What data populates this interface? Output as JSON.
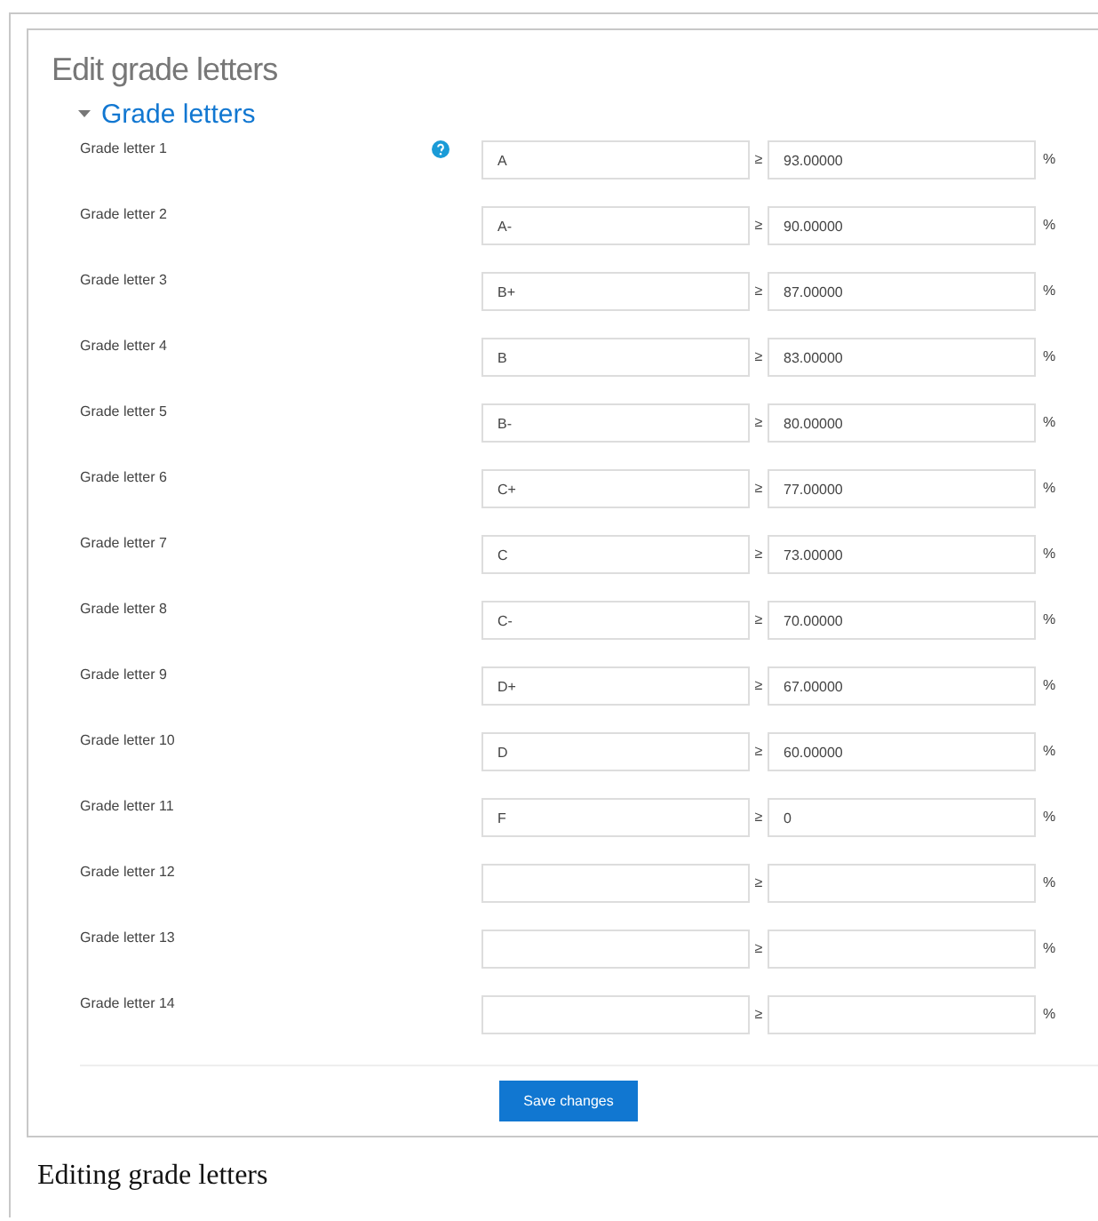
{
  "page_title": "Edit grade letters",
  "section": {
    "title": "Grade letters",
    "expanded": true
  },
  "rows": [
    {
      "label": "Grade letter 1",
      "help": true,
      "letter": "A",
      "sign": "≥",
      "boundary": "93.00000",
      "unit": "%"
    },
    {
      "label": "Grade letter 2",
      "help": false,
      "letter": "A-",
      "sign": "≥",
      "boundary": "90.00000",
      "unit": "%"
    },
    {
      "label": "Grade letter 3",
      "help": false,
      "letter": "B+",
      "sign": "≥",
      "boundary": "87.00000",
      "unit": "%"
    },
    {
      "label": "Grade letter 4",
      "help": false,
      "letter": "B",
      "sign": "≥",
      "boundary": "83.00000",
      "unit": "%"
    },
    {
      "label": "Grade letter 5",
      "help": false,
      "letter": "B-",
      "sign": "≥",
      "boundary": "80.00000",
      "unit": "%"
    },
    {
      "label": "Grade letter 6",
      "help": false,
      "letter": "C+",
      "sign": "≥",
      "boundary": "77.00000",
      "unit": "%"
    },
    {
      "label": "Grade letter 7",
      "help": false,
      "letter": "C",
      "sign": "≥",
      "boundary": "73.00000",
      "unit": "%"
    },
    {
      "label": "Grade letter 8",
      "help": false,
      "letter": "C-",
      "sign": "≥",
      "boundary": "70.00000",
      "unit": "%"
    },
    {
      "label": "Grade letter 9",
      "help": false,
      "letter": "D+",
      "sign": "≥",
      "boundary": "67.00000",
      "unit": "%"
    },
    {
      "label": "Grade letter 10",
      "help": false,
      "letter": "D",
      "sign": "≥",
      "boundary": "60.00000",
      "unit": "%"
    },
    {
      "label": "Grade letter 11",
      "help": false,
      "letter": "F",
      "sign": "≥",
      "boundary": "0",
      "unit": "%"
    },
    {
      "label": "Grade letter 12",
      "help": false,
      "sign": "≥",
      "unit": "%"
    },
    {
      "label": "Grade letter 13",
      "help": false,
      "sign": "≥",
      "unit": "%"
    },
    {
      "label": "Grade letter 14",
      "help": false,
      "sign": "≥",
      "unit": "%"
    }
  ],
  "save_button": "Save changes",
  "caption": "Editing grade letters"
}
